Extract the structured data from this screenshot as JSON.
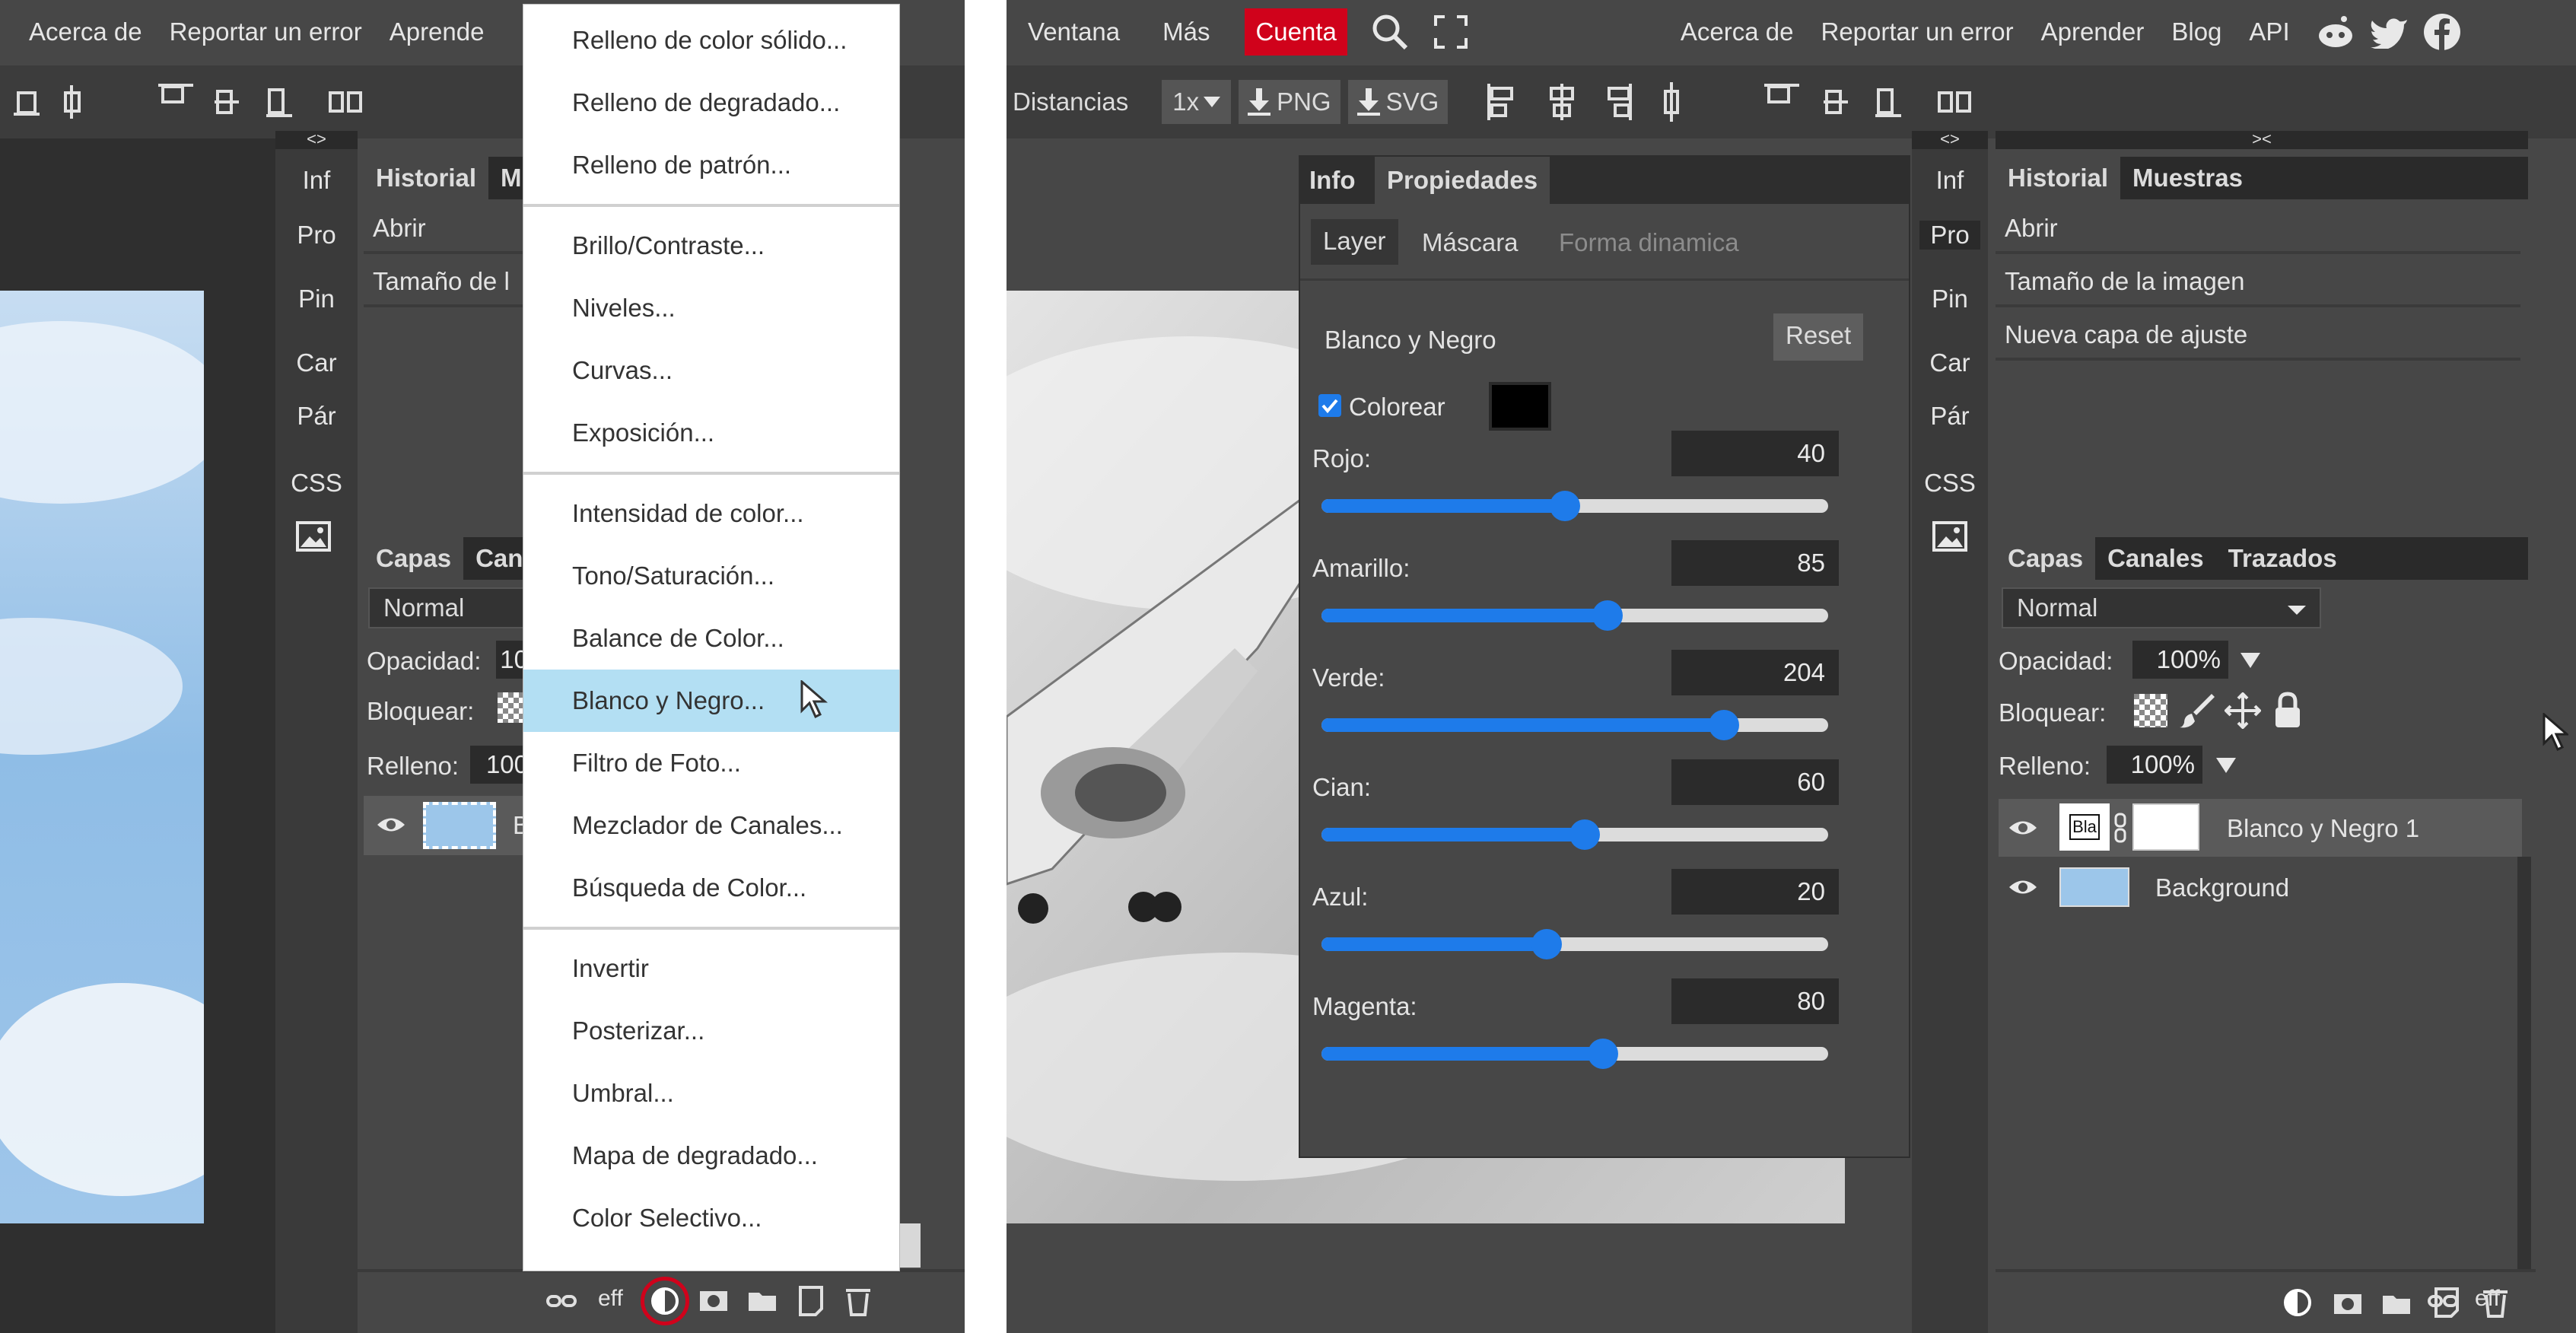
{
  "left": {
    "topnav": [
      "Acerca de",
      "Reportar un error",
      "Aprende"
    ],
    "sidebar": [
      "Inf",
      "Pro",
      "Pin",
      "Car",
      "Pár",
      "CSS"
    ],
    "history": {
      "tab1": "Historial",
      "tab2": "M",
      "items": [
        "Abrir",
        "Tamaño de l"
      ]
    },
    "layers": {
      "tab1": "Capas",
      "tab2": "Can",
      "blend": "Normal",
      "opacity_label": "Opacidad:",
      "opacity_value": "10",
      "lock_label": "Bloquear:",
      "fill_label": "Relleno:",
      "fill_value": "100",
      "layer_name": "B"
    },
    "footer_eff": "eff",
    "menu": [
      {
        "label": "Relleno de color sólido..."
      },
      {
        "label": "Relleno de degradado..."
      },
      {
        "label": "Relleno de patrón..."
      },
      {
        "sep": true
      },
      {
        "label": "Brillo/Contraste..."
      },
      {
        "label": "Niveles..."
      },
      {
        "label": "Curvas..."
      },
      {
        "label": "Exposición..."
      },
      {
        "sep": true
      },
      {
        "label": "Intensidad de color..."
      },
      {
        "label": "Tono/Saturación..."
      },
      {
        "label": "Balance de Color..."
      },
      {
        "label": "Blanco y Negro...",
        "highlight": true
      },
      {
        "label": "Filtro de Foto..."
      },
      {
        "label": "Mezclador de Canales..."
      },
      {
        "label": "Búsqueda de Color..."
      },
      {
        "sep": true
      },
      {
        "label": "Invertir"
      },
      {
        "label": "Posterizar..."
      },
      {
        "label": "Umbral..."
      },
      {
        "label": "Mapa de degradado..."
      },
      {
        "label": "Color Selectivo..."
      }
    ]
  },
  "right": {
    "topnav": {
      "ventana": "Ventana",
      "mas": "Más",
      "cuenta": "Cuenta",
      "acerca": "Acerca de",
      "reportar": "Reportar un error",
      "aprender": "Aprender",
      "blog": "Blog",
      "api": "API"
    },
    "toolbar": {
      "distancias": "Distancias",
      "scale": "1x",
      "png": "PNG",
      "svg": "SVG"
    },
    "sidebar": [
      "Inf",
      "Pro",
      "Pin",
      "Car",
      "Pár",
      "CSS"
    ],
    "props": {
      "tab_info": "Info",
      "tab_props": "Propiedades",
      "sub_layer": "Layer",
      "sub_mask": "Máscara",
      "sub_shape": "Forma dinamica",
      "title": "Blanco y Negro",
      "reset": "Reset",
      "colorize": "Colorear",
      "tint_color": "#000000",
      "sliders": [
        {
          "label": "Rojo:",
          "value": 40,
          "fraction": 0.48
        },
        {
          "label": "Amarillo:",
          "value": 85,
          "fraction": 0.565
        },
        {
          "label": "Verde:",
          "value": 204,
          "fraction": 0.795
        },
        {
          "label": "Cian:",
          "value": 60,
          "fraction": 0.52
        },
        {
          "label": "Azul:",
          "value": 20,
          "fraction": 0.445
        },
        {
          "label": "Magenta:",
          "value": 80,
          "fraction": 0.555
        }
      ]
    },
    "history": {
      "tab1": "Historial",
      "tab2": "Muestras",
      "items": [
        "Abrir",
        "Tamaño de la imagen",
        "Nueva capa de ajuste"
      ]
    },
    "layers": {
      "tab1": "Capas",
      "tab2": "Canales",
      "tab3": "Trazados",
      "blend": "Normal",
      "opacity_label": "Opacidad:",
      "opacity_value": "100%",
      "lock_label": "Bloquear:",
      "fill_label": "Relleno:",
      "fill_value": "100%",
      "items": [
        {
          "name": "Blanco y Negro 1",
          "thumb_text": "Bla"
        },
        {
          "name": "Background"
        }
      ]
    },
    "footer_eff": "eff"
  },
  "colors": {
    "accent": "#1e7bea",
    "cuenta": "#d0021b",
    "highlight": "#b3dff3",
    "panel": "#474747"
  }
}
